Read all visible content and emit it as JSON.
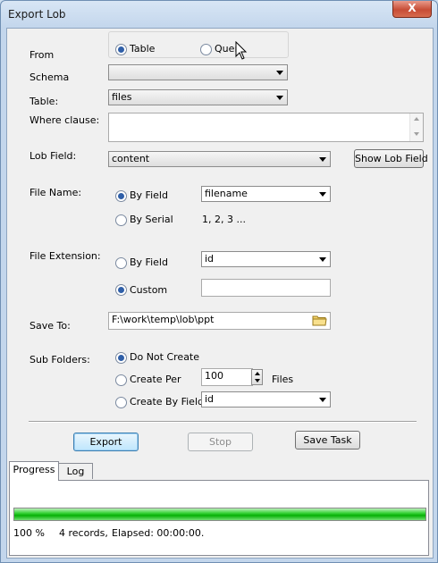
{
  "window": {
    "title": "Export Lob",
    "close": "X"
  },
  "from": {
    "label": "From",
    "options": [
      {
        "label": "Table",
        "selected": true
      },
      {
        "label": "Query",
        "selected": false
      }
    ]
  },
  "schema": {
    "label": "Schema",
    "value": ""
  },
  "table": {
    "label": "Table:",
    "value": "files"
  },
  "where": {
    "label": "Where clause:",
    "value": ""
  },
  "lob_field": {
    "label": "Lob Field:",
    "value": "content",
    "button": "Show Lob Field"
  },
  "file_name": {
    "label": "File Name:",
    "by_field": "By Field",
    "by_field_selected": true,
    "field_value": "filename",
    "by_serial": "By Serial",
    "serial_text": "1, 2, 3 ..."
  },
  "file_ext": {
    "label": "File Extension:",
    "by_field": "By Field",
    "field_value": "id",
    "custom": "Custom",
    "custom_selected": true,
    "custom_value": ""
  },
  "save_to": {
    "label": "Save To:",
    "value": "F:\\work\\temp\\lob\\ppt"
  },
  "sub_folders": {
    "label": "Sub Folders:",
    "do_not_create": "Do Not Create",
    "create_per": "Create Per",
    "per_value": "100",
    "files": "Files",
    "create_by_field": "Create By Field",
    "field_value": "id"
  },
  "buttons": {
    "export": "Export",
    "stop": "Stop",
    "save_task": "Save Task"
  },
  "tabs": [
    {
      "label": "Progress",
      "active": true
    },
    {
      "label": "Log",
      "active": false
    }
  ],
  "progress": {
    "fraction": 1.0,
    "percent": "100 %",
    "records": "4 records,",
    "elapsed": "Elapsed: 00:00:00."
  },
  "colors": {
    "accent": "#2f5fa8",
    "progress": "#06b006",
    "title_bar": "#c3d6ec"
  }
}
